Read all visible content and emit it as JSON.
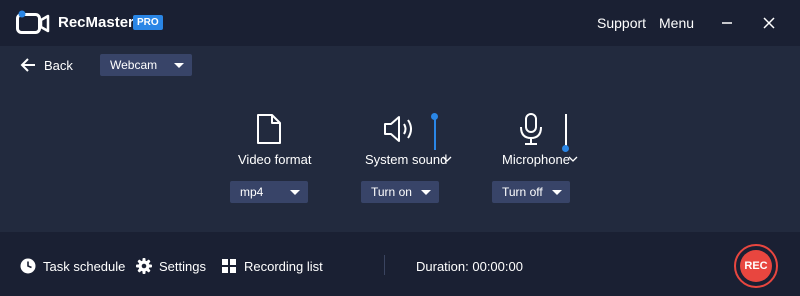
{
  "app": {
    "name": "RecMaster",
    "badge": "PRO"
  },
  "header": {
    "support": "Support",
    "menu": "Menu"
  },
  "nav": {
    "back": "Back",
    "mode_select": {
      "value": "Webcam"
    }
  },
  "controls": {
    "video_format": {
      "label": "Video format",
      "value": "mp4",
      "icon": "file-icon"
    },
    "system_sound": {
      "label": "System sound",
      "value": "Turn on",
      "icon": "speaker-icon",
      "volume_level": 1.0
    },
    "microphone": {
      "label": "Microphone",
      "value": "Turn off",
      "icon": "microphone-icon",
      "volume_level": 0.0
    }
  },
  "footer": {
    "task_schedule": "Task schedule",
    "settings": "Settings",
    "recording_list": "Recording list",
    "duration": "Duration: 00:00:00",
    "rec": "REC"
  },
  "colors": {
    "accent": "#2a86e6",
    "rec": "#e8463f",
    "background": "#222a3e",
    "bar": "#1a2033",
    "dropdown": "#384468"
  }
}
